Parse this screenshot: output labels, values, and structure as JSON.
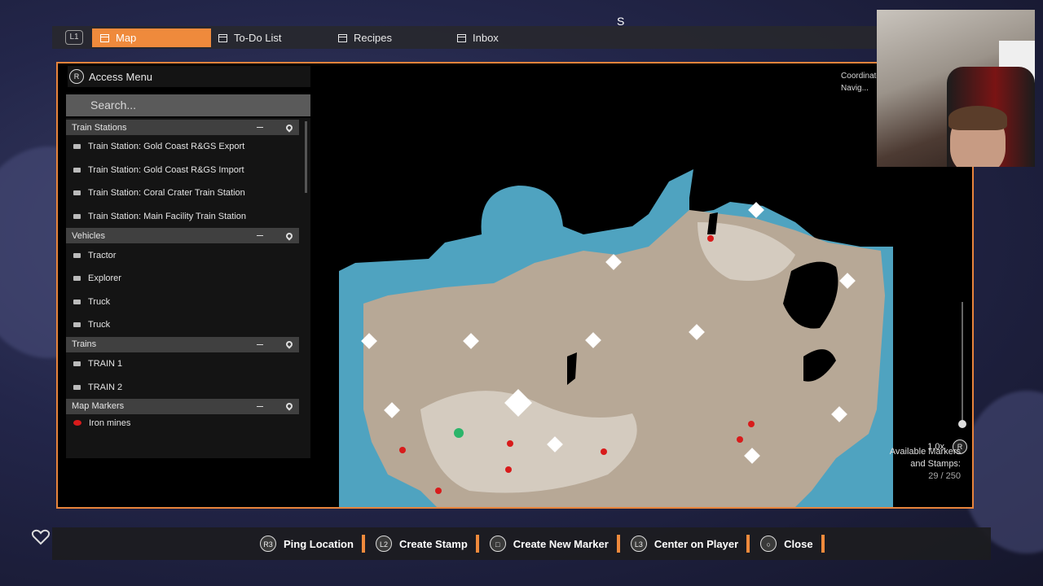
{
  "tabs": {
    "l1_label": "L1",
    "items": [
      {
        "label": "Map",
        "active": true
      },
      {
        "label": "To-Do List",
        "active": false
      },
      {
        "label": "Recipes",
        "active": false
      },
      {
        "label": "Inbox",
        "active": false
      }
    ]
  },
  "access_menu": {
    "button": "R",
    "label": "Access Menu"
  },
  "search": {
    "placeholder": "Search..."
  },
  "groups": {
    "train_stations": {
      "title": "Train Stations",
      "items": [
        "Train Station: Gold Coast R&GS Export",
        "Train Station: Gold Coast R&GS Import",
        "Train Station: Coral Crater Train Station",
        "Train Station: Main Facility Train Station"
      ]
    },
    "vehicles": {
      "title": "Vehicles",
      "items": [
        "Tractor",
        "Explorer",
        "Truck",
        "Truck"
      ]
    },
    "trains": {
      "title": "Trains",
      "items": [
        "TRAIN 1",
        "TRAIN 2"
      ]
    },
    "map_markers": {
      "title": "Map Markers",
      "items": [
        "Iron mines"
      ]
    }
  },
  "map_info": {
    "coordinates_label": "Coordinates: 605, -2...",
    "navigation_label": "Navig...",
    "zoom_level": "1.0x",
    "zoom_button": "R",
    "markers_label_1": "Available Markers",
    "markers_label_2": "and Stamps:",
    "markers_count": "29 / 250"
  },
  "prompts": [
    {
      "button": "R3",
      "label": "Ping Location"
    },
    {
      "button": "L2",
      "label": "Create Stamp"
    },
    {
      "button": "□",
      "label": "Create New Marker"
    },
    {
      "button": "L3",
      "label": "Center on Player"
    },
    {
      "button": "○",
      "label": "Close"
    }
  ],
  "colors": {
    "accent": "#ef8a3c",
    "water": "#4fa3c0",
    "land": "#b7a896",
    "marker": "#d81b1b"
  },
  "top_center_glyph": "S"
}
